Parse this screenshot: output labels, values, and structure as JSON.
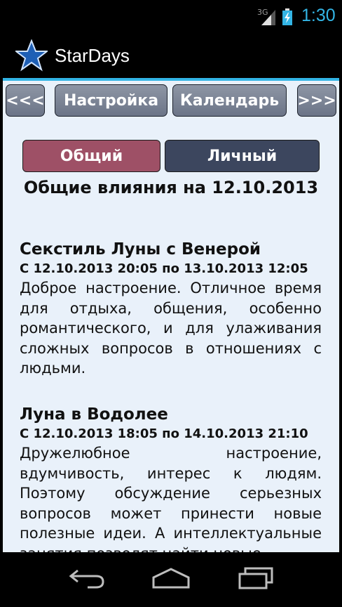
{
  "status_bar": {
    "network": "3G",
    "time": "1:30",
    "icons": [
      "signal-icon",
      "battery-charging-icon"
    ]
  },
  "app": {
    "title": "StarDays",
    "logo_icon": "star-logo-icon"
  },
  "nav": {
    "prev_label": "<<<",
    "settings_label": "Настройка",
    "calendar_label": "Календарь",
    "next_label": ">>>"
  },
  "tabs": {
    "general_label": "Общий",
    "personal_label": "Личный",
    "selected": "general"
  },
  "heading": "Общие влияния на 12.10.2013",
  "events": [
    {
      "title": "Секстиль Луны с Венерой",
      "period": "С 12.10.2013 20:05 по 13.10.2013 12:05",
      "description": "Доброе настроение. Отличное время для отдыха, общения, особенно романтического, и для улаживания сложных вопросов в отношениях с людьми."
    },
    {
      "title": "Луна в Водолее",
      "period": "С 12.10.2013 18:05 по 14.10.2013 21:10",
      "description": "Дружелюбное настроение, вдумчивость, интерес к людям. Поэтому обсуждение серьезных вопросов может принести новые полезные идеи. А интеллектуальные занятия позволят найти новые"
    }
  ],
  "system_nav": {
    "icons": [
      "back-icon",
      "home-icon",
      "recent-apps-icon"
    ]
  },
  "colors": {
    "accent": "#33b5e5",
    "tab_selected": "#9e5066",
    "tab_unselected": "#3c465e",
    "content_background": "#e9f1fa"
  }
}
